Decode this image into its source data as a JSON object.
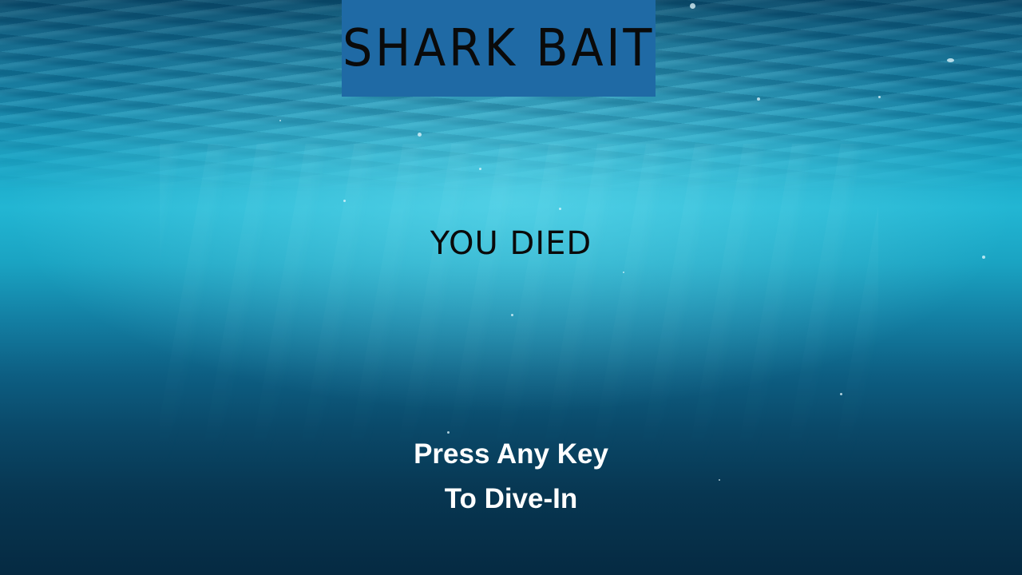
{
  "game": {
    "title": "Shark Bait",
    "status": "You Died",
    "prompt_line1": "Press Any Key",
    "prompt_line2": "To Dive-In"
  },
  "colors": {
    "title_box": "#1f6aa5",
    "title_text": "#0a0a0a",
    "prompt_text": "#ffffff",
    "water_top": "#0b4e6e",
    "water_mid": "#22b6d3",
    "water_bottom": "#052a42"
  }
}
